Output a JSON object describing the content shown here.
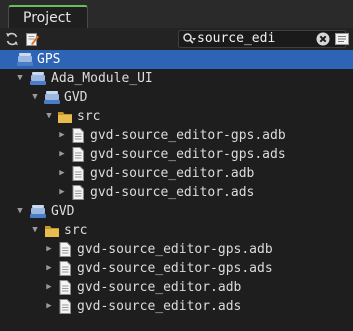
{
  "tab": {
    "label": "Project"
  },
  "toolbar": {
    "reload_icon": "refresh-icon",
    "edit_icon": "edit-document-icon"
  },
  "search": {
    "value": "source_edi",
    "clear_icon": "clear-icon",
    "options_icon": "options-icon"
  },
  "tree": {
    "root": {
      "label": "GPS"
    },
    "project1": {
      "label": "Ada_Module_UI"
    },
    "p1_gvd": {
      "label": "GVD"
    },
    "p1_src": {
      "label": "src"
    },
    "p1_files": [
      {
        "label": "gvd-source_editor-gps.adb"
      },
      {
        "label": "gvd-source_editor-gps.ads"
      },
      {
        "label": "gvd-source_editor.adb"
      },
      {
        "label": "gvd-source_editor.ads"
      }
    ],
    "project2": {
      "label": "GVD"
    },
    "p2_src": {
      "label": "src"
    },
    "p2_files": [
      {
        "label": "gvd-source_editor-gps.adb"
      },
      {
        "label": "gvd-source_editor-gps.ads"
      },
      {
        "label": "gvd-source_editor.adb"
      },
      {
        "label": "gvd-source_editor.ads"
      }
    ]
  },
  "colors": {
    "selection": "#2d64b5",
    "tab_accent": "#6bbd5b",
    "folder": "#e3b341"
  }
}
